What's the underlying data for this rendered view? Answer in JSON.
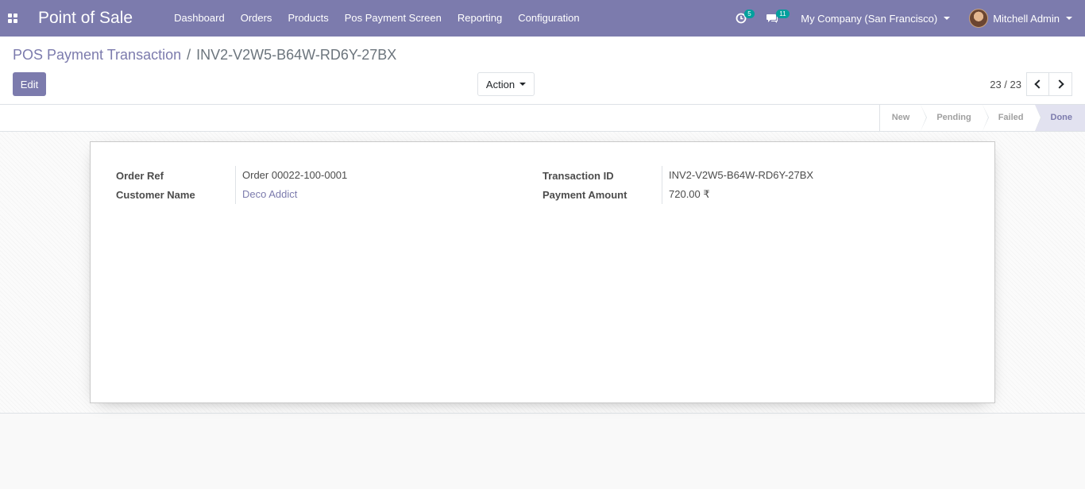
{
  "navbar": {
    "brand": "Point of Sale",
    "menu": [
      "Dashboard",
      "Orders",
      "Products",
      "Pos Payment Screen",
      "Reporting",
      "Configuration"
    ],
    "activity_count": "5",
    "messages_count": "11",
    "company": "My Company (San Francisco)",
    "user": "Mitchell Admin",
    "accent_color": "#7c7bad",
    "badge_color": "#00a09d"
  },
  "breadcrumb": {
    "parent": "POS Payment Transaction",
    "separator": "/",
    "current": "INV2-V2W5-B64W-RD6Y-27BX"
  },
  "toolbar": {
    "edit_label": "Edit",
    "action_label": "Action"
  },
  "pager": {
    "value": "23 / 23"
  },
  "statusbar": {
    "steps": [
      "New",
      "Pending",
      "Failed",
      "Done"
    ],
    "active": "Done"
  },
  "form": {
    "left": [
      {
        "label": "Order Ref",
        "value": "Order 00022-100-0001"
      },
      {
        "label": "Customer Name",
        "value": "Deco Addict"
      }
    ],
    "right": [
      {
        "label": "Transaction ID",
        "value": "INV2-V2W5-B64W-RD6Y-27BX"
      },
      {
        "label": "Payment Amount",
        "value": "720.00 ₹"
      }
    ]
  }
}
